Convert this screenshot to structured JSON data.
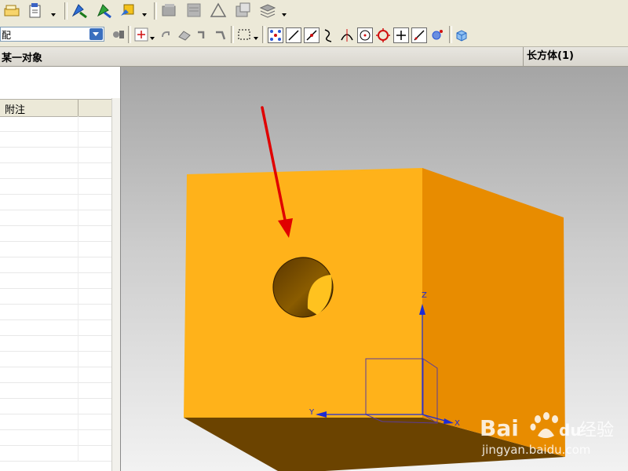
{
  "toolbar": {
    "filter_value": "配",
    "icons": [
      "note-icon",
      "paste-icon",
      "tool-blue-icon",
      "tool-green-icon",
      "tool-yellow-icon",
      "layer-icon",
      "sheet-icon",
      "triangle-icon",
      "grid-icon",
      "stack-icon"
    ],
    "snap_icons": [
      "snap-point-icon",
      "snap-line-icon",
      "snap-end-icon",
      "snap-curve-icon",
      "snap-tangent-icon",
      "snap-center-icon",
      "snap-circle-icon",
      "snap-cross-icon",
      "snap-diagonal-icon",
      "snap-arc-icon",
      "view-cube-icon"
    ]
  },
  "status": {
    "prompt": "某一对象",
    "selection": "长方体(1)"
  },
  "navigator": {
    "columns": [
      "附注",
      ""
    ],
    "row_count": 22
  },
  "viewport": {
    "axis_z": "Z",
    "axis_y": "Y",
    "axis_x": "X",
    "box_color_front": "#ffb21a",
    "box_color_side": "#e88c00",
    "box_color_bottom": "#6b4300",
    "arrow_color": "#e00000"
  },
  "watermark": {
    "brand": "Bai",
    "brand2": "du",
    "cn": "经验",
    "url": "jingyan.baidu.com"
  }
}
